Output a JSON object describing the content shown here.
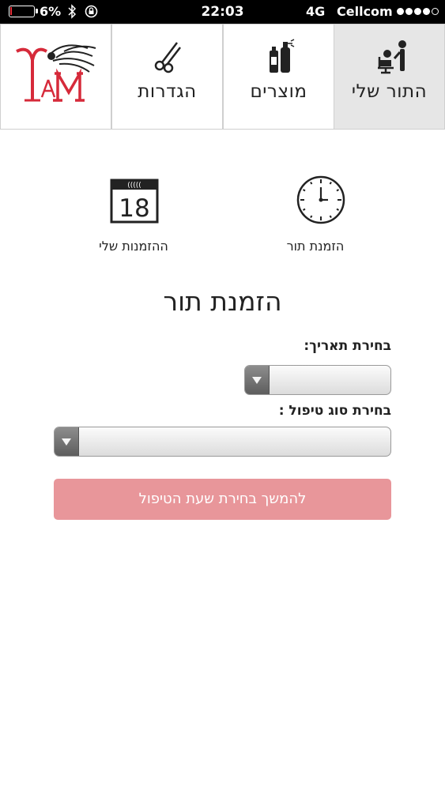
{
  "status_bar": {
    "battery": "6%",
    "battery_level": 0.06,
    "time": "22:03",
    "network": "4G",
    "carrier": "Cellcom",
    "signal_bars_filled": 4,
    "signal_bars_total": 5,
    "colors": {
      "background": "#000000",
      "battery_low": "#e8303a"
    }
  },
  "tabs": [
    {
      "label": "התור שלי",
      "icon": "haircut-chair-icon",
      "active": true
    },
    {
      "label": "מוצרים",
      "icon": "hair-products-icon",
      "active": false
    },
    {
      "label": "הגדרות",
      "icon": "scissors-icon",
      "active": false
    }
  ],
  "logo": {
    "text": "Y&M",
    "color": "#d62a3a"
  },
  "home": {
    "book_label": "הזמנת תור",
    "my_bookings_label": "ההזמנות שלי",
    "calendar_day": "18",
    "calendar_rings": "((((("
  },
  "form": {
    "title": "הזמנת תור",
    "date_label": "בחירת תאריך:",
    "date_value": "",
    "treatment_label": "בחירת סוג טיפול :",
    "treatment_value": "",
    "submit_label": "להמשך בחירת שעת הטיפול",
    "submit_color": "#e8969a"
  }
}
